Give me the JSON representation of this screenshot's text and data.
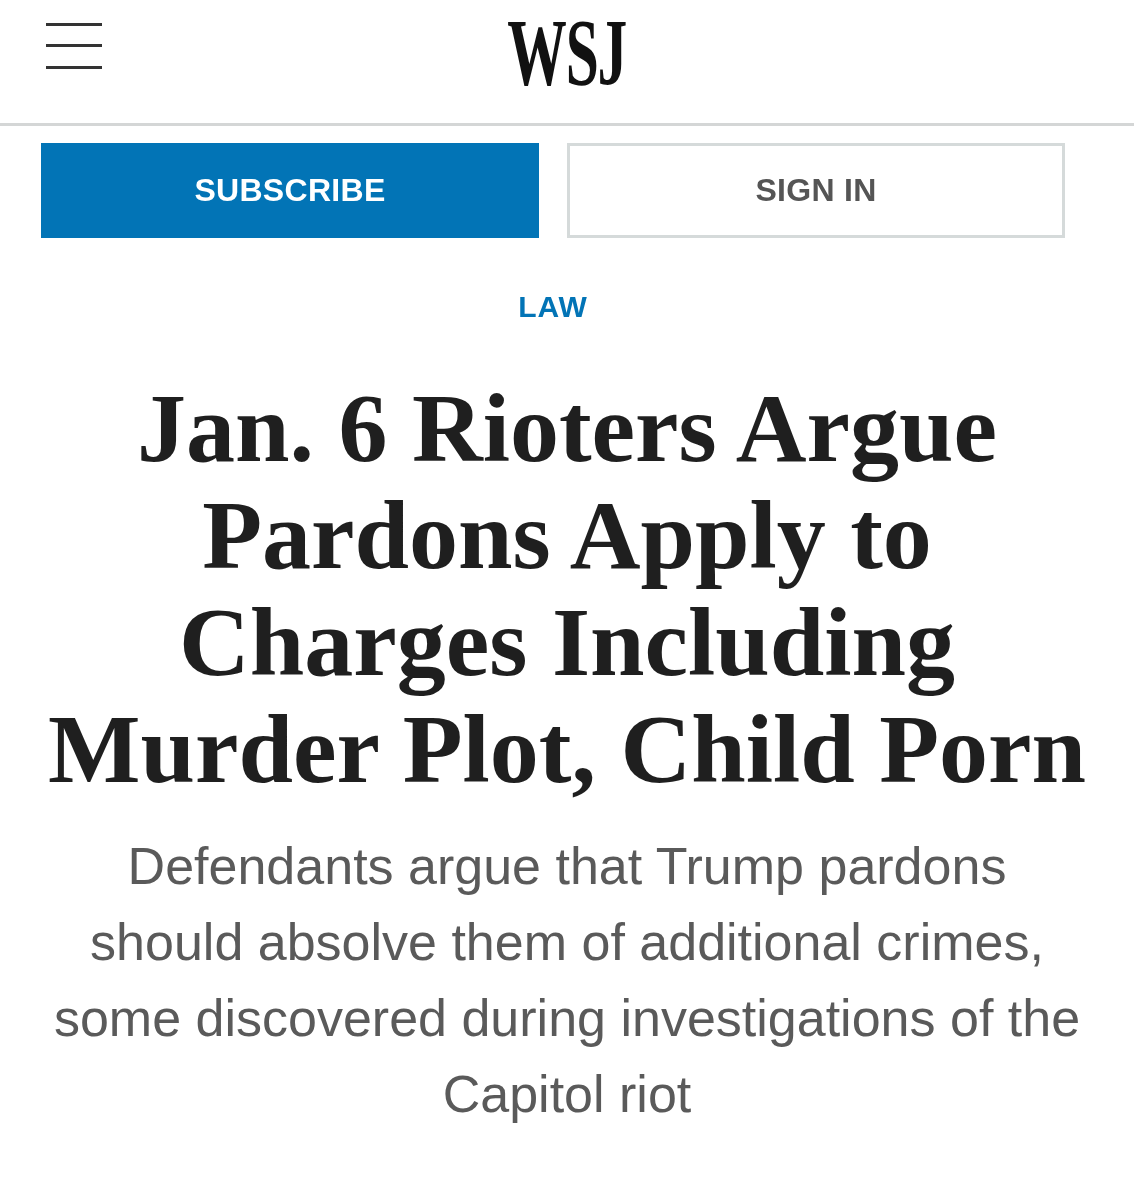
{
  "header": {
    "logo": "WSJ"
  },
  "actions": [
    {
      "label": "SUBSCRIBE",
      "kind": "primary"
    },
    {
      "label": "SIGN IN",
      "kind": "secondary"
    }
  ],
  "article": {
    "section": "LAW",
    "headline": "Jan. 6 Rioters Argue Pardons Apply to Charges Including Murder Plot, Child Porn",
    "dek": "Defendants argue that Trump pardons should absolve them of additional crimes, some discovered during investigations of the Capitol riot"
  }
}
